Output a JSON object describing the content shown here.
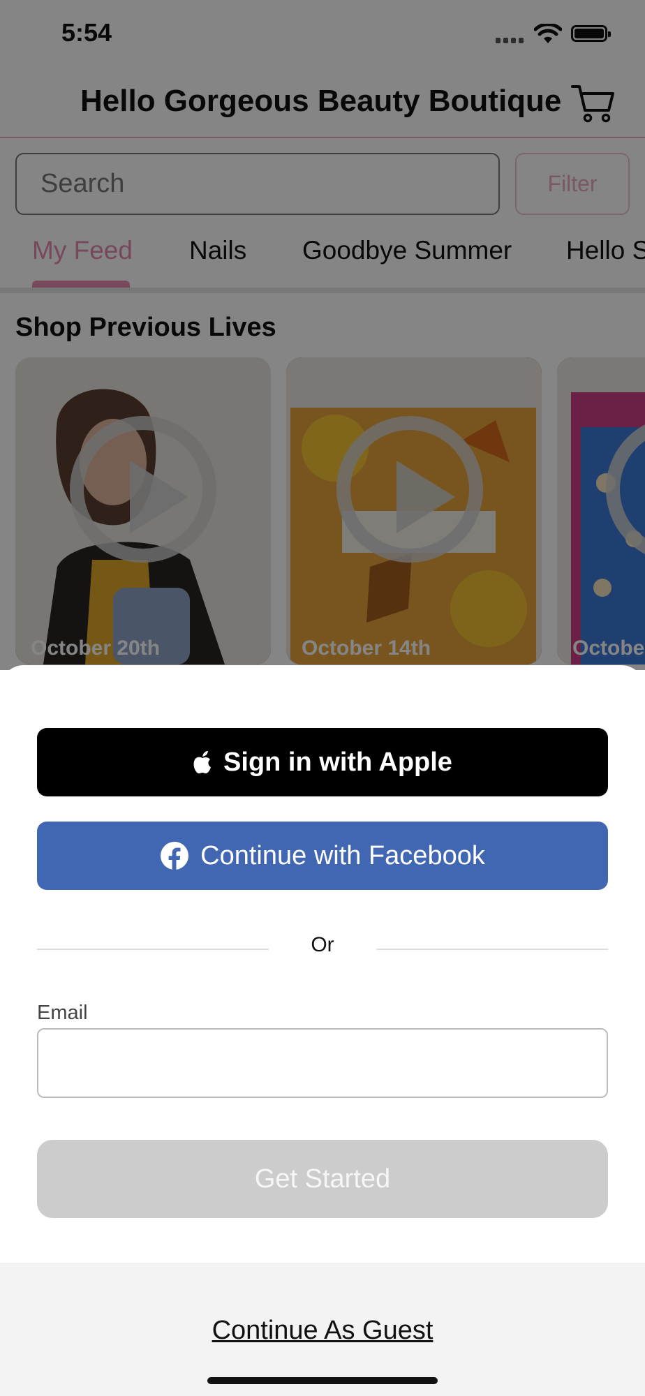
{
  "status_bar": {
    "time": "5:54"
  },
  "header": {
    "title": "Hello Gorgeous Beauty Boutique",
    "cart_icon": "cart-icon"
  },
  "search": {
    "placeholder": "Search",
    "filter_label": "Filter"
  },
  "tabs": [
    {
      "label": "My Feed",
      "active": true
    },
    {
      "label": "Nails"
    },
    {
      "label": "Goodbye Summer"
    },
    {
      "label": "Hello S"
    }
  ],
  "section": {
    "title": "Shop Previous Lives",
    "cards": [
      {
        "date": "October 20th"
      },
      {
        "date": "October 14th"
      },
      {
        "date": "Octobe"
      }
    ]
  },
  "sheet": {
    "apple_label": "Sign in with Apple",
    "facebook_label": "Continue with Facebook",
    "or_label": "Or",
    "email_label": "Email",
    "email_value": "",
    "get_started_label": "Get Started",
    "guest_label": "Continue As Guest"
  },
  "colors": {
    "accent_pink": "#ea8ab1",
    "facebook_blue": "#4267b2",
    "apple_black": "#000000",
    "disabled_gray": "#cccccc"
  }
}
